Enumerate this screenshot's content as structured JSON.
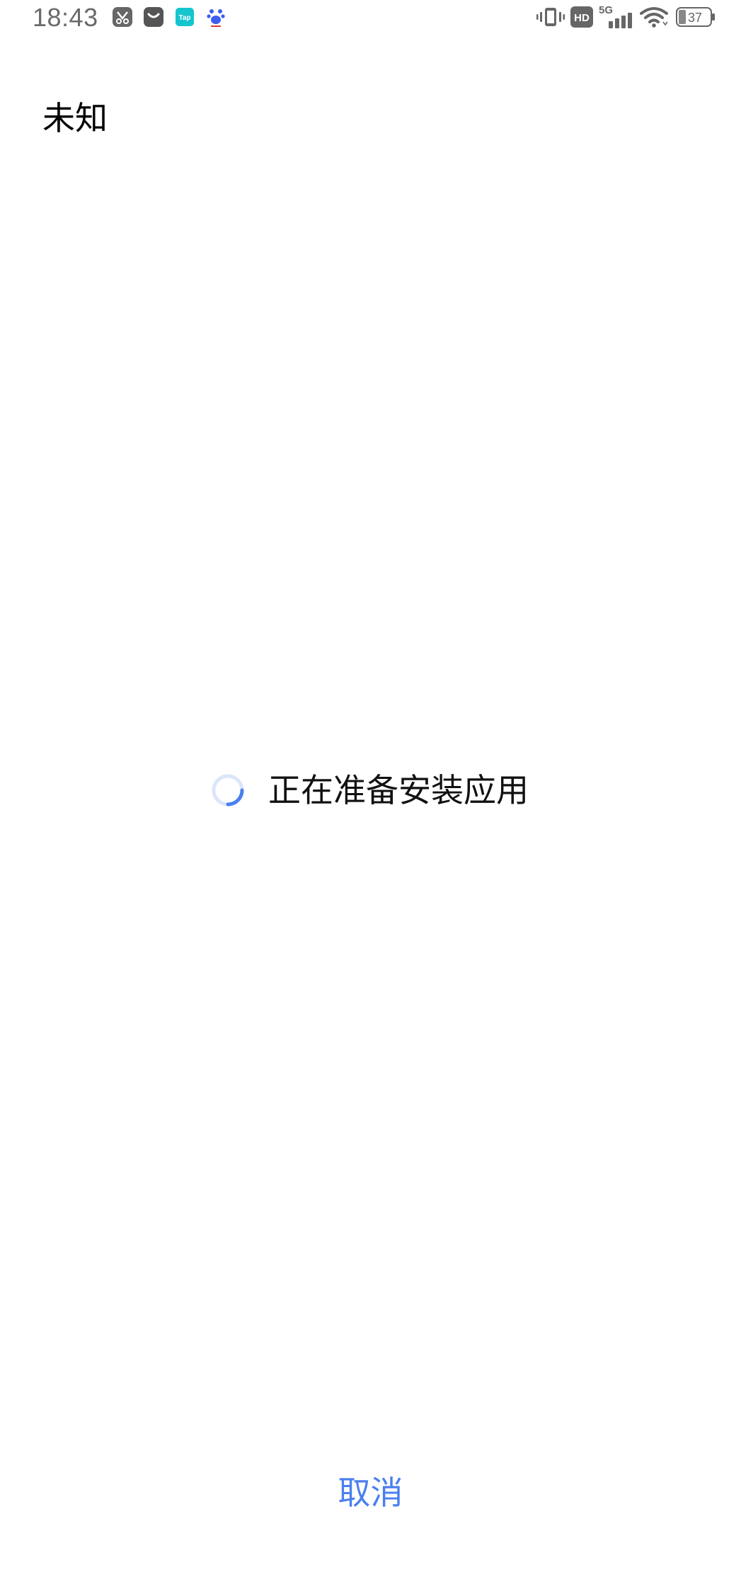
{
  "status_bar": {
    "time": "18:43",
    "battery_level": "37",
    "network_label": "5G",
    "hd_label": "HD",
    "notification_icons": [
      "scissors-app-icon",
      "shopping-bag-icon",
      "taptap-icon",
      "baidu-paw-icon"
    ],
    "taptap_label": "Tap"
  },
  "header": {
    "title": "未知"
  },
  "main": {
    "loading_text": "正在准备安装应用"
  },
  "footer": {
    "cancel_label": "取消"
  },
  "colors": {
    "accent": "#4a7ff0",
    "spinner_track": "#dbe6fb",
    "spinner_arc": "#4a7ff0",
    "status_gray": "#6a6a6a"
  }
}
